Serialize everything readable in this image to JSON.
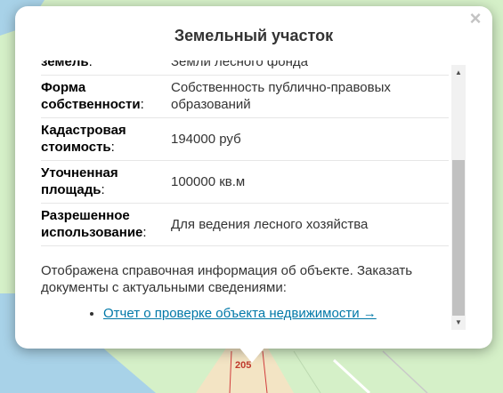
{
  "popup": {
    "title": "Земельный участок",
    "close_glyph": "×"
  },
  "properties": [
    {
      "label": "земель",
      "colon": ":",
      "value": "Земли лесного фонда"
    },
    {
      "label": "Форма",
      "label2": "собственности",
      "colon": ":",
      "value": "Собственность публично-правовых образований"
    },
    {
      "label": "Кадастровая",
      "label2": "стоимость",
      "colon": ":",
      "value": "194000 руб"
    },
    {
      "label": "Уточненная",
      "label2": "площадь",
      "colon": ":",
      "value": "100000 кв.м"
    },
    {
      "label": "Разрешенное",
      "label2": "использование",
      "colon": ":",
      "value": "Для ведения лесного хозяйства"
    }
  ],
  "info": {
    "text": "Отображена справочная информация об объекте. Заказать документы с актуальными сведениями:",
    "link": "Отчет о проверке объекта недвижимости →"
  },
  "map": {
    "label": "205",
    "colors": {
      "land": "#d5f0c8",
      "water": "#a8d2e8",
      "road": "#f3e4c4",
      "parcel_line": "#d23c3c"
    }
  },
  "scrollbar": {
    "up_glyph": "▲",
    "down_glyph": "▼"
  }
}
